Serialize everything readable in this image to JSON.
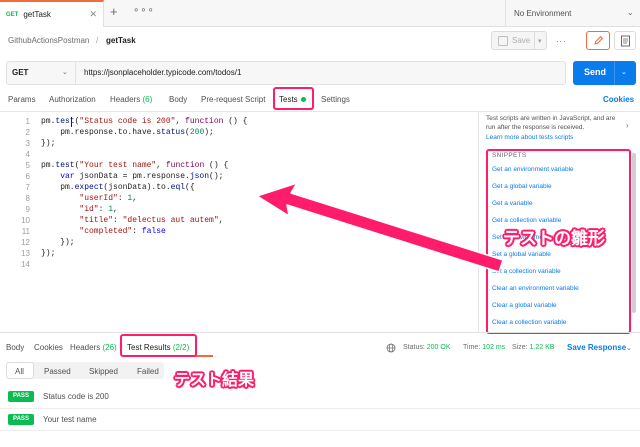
{
  "tabstrip": {
    "request_tab": {
      "method": "GET",
      "title": "getTask"
    },
    "new_tab": "+",
    "more": "∘∘∘",
    "environment": "No Environment"
  },
  "breadcrumb": {
    "collection": "GithubActionsPostman",
    "separator": "/",
    "request": "getTask"
  },
  "toolbar": {
    "save_label": "Save",
    "more": "∙∙∙"
  },
  "request": {
    "method": "GET",
    "url": "https://jsonplaceholder.typicode.com/todos/1",
    "send_label": "Send"
  },
  "request_tabs": {
    "params": "Params",
    "authorization": "Authorization",
    "headers": "Headers",
    "headers_count": "(6)",
    "body": "Body",
    "prerequest": "Pre-request Script",
    "tests": "Tests",
    "settings": "Settings",
    "cookies": "Cookies"
  },
  "editor": {
    "line_numbers": [
      "1",
      "2",
      "3",
      "4",
      "5",
      "6",
      "7",
      "8",
      "9",
      "10",
      "11",
      "12",
      "13",
      "14"
    ]
  },
  "snippets": {
    "info": "Test scripts are written in JavaScript, and are run after the response is received.",
    "learn_more": "Learn more about tests scripts",
    "title": "SNIPPETS",
    "items": [
      "Get an environment variable",
      "Get a global variable",
      "Get a variable",
      "Get a collection variable",
      "Set an environment variable",
      "Set a global variable",
      "Set a collection variable",
      "Clear an environment variable",
      "Clear a global variable",
      "Clear a collection variable"
    ]
  },
  "annotations": {
    "template_label": "テストの雛形",
    "results_label": "テスト結果",
    "accent_color": "#ff1d6b"
  },
  "response_tabs": {
    "body": "Body",
    "cookies": "Cookies",
    "headers": "Headers",
    "headers_count": "(26)",
    "test_results": "Test Results",
    "test_results_count": "(2/2)"
  },
  "response_status": {
    "status_label": "Status:",
    "status_value": "200 OK",
    "time_label": "Time:",
    "time_value": "102 ms",
    "size_label": "Size:",
    "size_value": "1.22 KB",
    "save_response": "Save Response"
  },
  "result_filters": [
    "All",
    "Passed",
    "Skipped",
    "Failed"
  ],
  "test_results": [
    {
      "status": "PASS",
      "name": "Status code is 200"
    },
    {
      "status": "PASS",
      "name": "Your test name"
    }
  ],
  "colors": {
    "brand_orange": "#f26b3a",
    "primary_blue": "#097bed",
    "success_green": "#0cbb52"
  }
}
